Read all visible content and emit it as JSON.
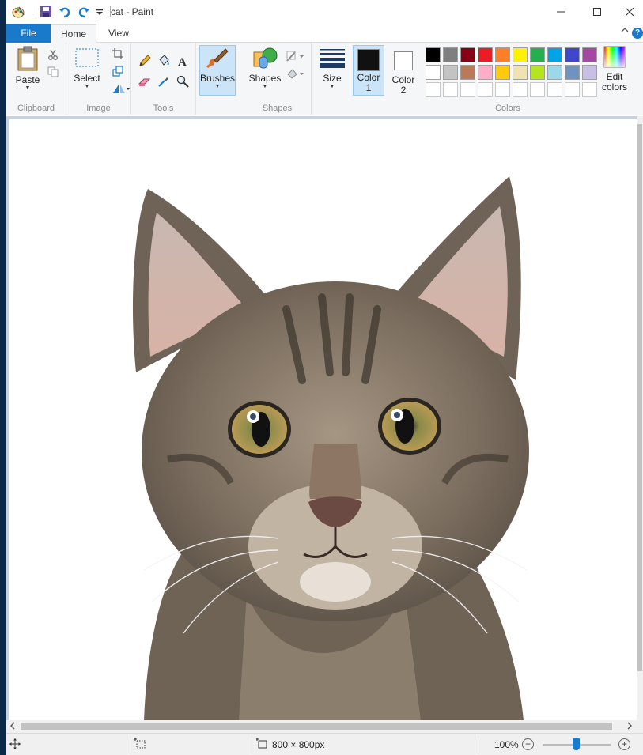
{
  "window": {
    "title": "cat - Paint"
  },
  "quick_access": [
    "paint-app-icon",
    "save-icon",
    "undo-icon",
    "redo-icon",
    "customize-qat-icon"
  ],
  "tabs": {
    "file": "File",
    "home": "Home",
    "view": "View"
  },
  "ribbon": {
    "clipboard": {
      "label": "Clipboard",
      "paste": "Paste"
    },
    "image": {
      "label": "Image",
      "select": "Select"
    },
    "tools": {
      "label": "Tools"
    },
    "brushes": {
      "label": "Brushes"
    },
    "shapes": {
      "label": "Shapes",
      "shapes_btn": "Shapes"
    },
    "size": {
      "label": "Size"
    },
    "colors": {
      "label": "Colors",
      "color1_line1": "Color",
      "color1_line2": "1",
      "color2_line1": "Color",
      "color2_line2": "2",
      "edit_line1": "Edit",
      "edit_line2": "colors",
      "color1_value": "#111111",
      "color2_value": "#ffffff",
      "palette_row1": [
        "#000000",
        "#7f7f7f",
        "#880015",
        "#ed1c24",
        "#ff7f27",
        "#fff200",
        "#22b14c",
        "#00a2e8",
        "#3f48cc",
        "#a349a4"
      ],
      "palette_row2": [
        "#ffffff",
        "#c3c3c3",
        "#b97a57",
        "#ffaec9",
        "#ffc90e",
        "#efe4b0",
        "#b5e61d",
        "#99d9ea",
        "#7092be",
        "#c8bfe7"
      ]
    }
  },
  "status": {
    "image_size": "800 × 800px",
    "zoom": "100%"
  }
}
